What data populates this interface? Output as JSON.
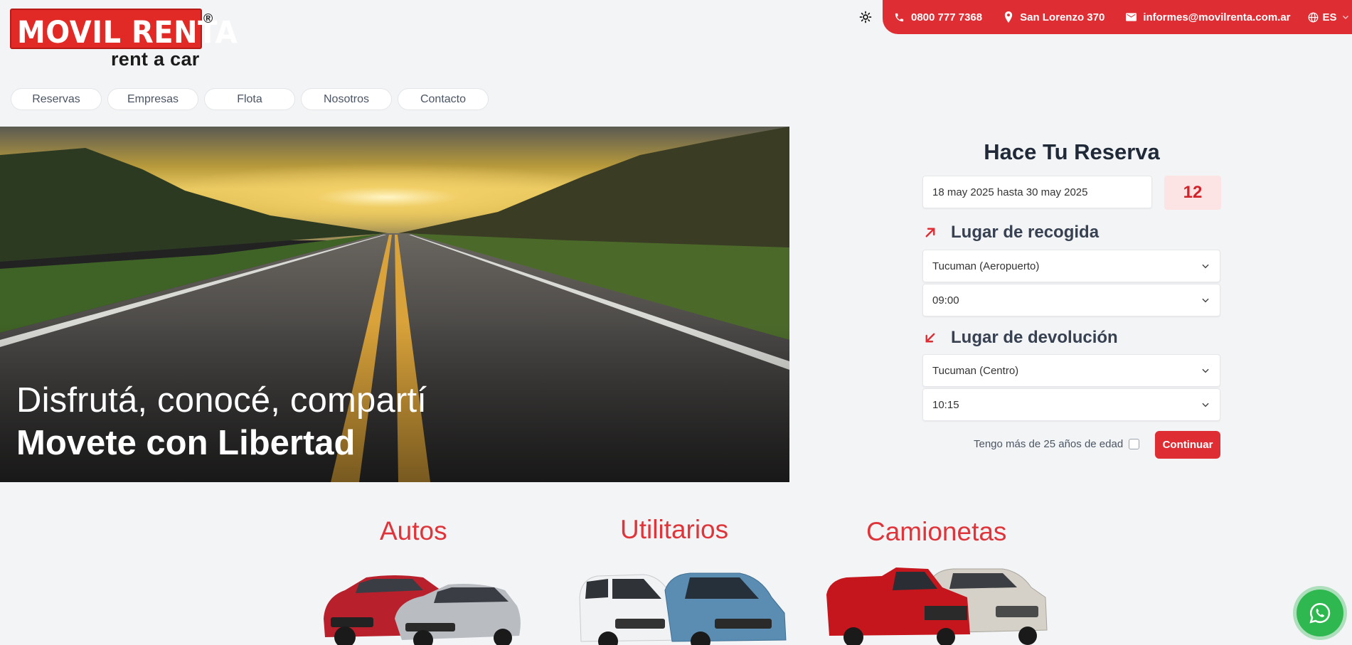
{
  "brand": {
    "name": "MOVIL RENTA",
    "registered": "®",
    "tagline": "rent a car",
    "color": "#e12a26"
  },
  "topbar": {
    "theme_icon": "sun-icon",
    "phone": "0800 777 7368",
    "address": "San Lorenzo 370",
    "email": "informes@movilrenta.com.ar",
    "language": "ES",
    "bar_color": "#df2d34"
  },
  "nav": {
    "items": [
      {
        "label": "Reservas"
      },
      {
        "label": "Empresas"
      },
      {
        "label": "Flota"
      },
      {
        "label": "Nosotros"
      },
      {
        "label": "Contacto"
      }
    ]
  },
  "hero": {
    "line1": "Disfrutá, conocé, compartí",
    "line2": "Movete con Libertad"
  },
  "booking": {
    "title": "Hace Tu Reserva",
    "date_range": "18 may 2025 hasta 30 may 2025",
    "days": "12",
    "pickup": {
      "heading": "Lugar de recogida",
      "location": "Tucuman (Aeropuerto)",
      "time": "09:00"
    },
    "dropoff": {
      "heading": "Lugar de devolución",
      "location": "Tucuman (Centro)",
      "time": "10:15"
    },
    "age_label": "Tengo más de 25 años de edad",
    "age_checked": false,
    "submit_label": "Continuar"
  },
  "categories": [
    {
      "label": "Autos"
    },
    {
      "label": "Utilitarios"
    },
    {
      "label": "Camionetas"
    }
  ],
  "whatsapp": {
    "icon": "whatsapp-icon",
    "color": "#2fb84f"
  }
}
